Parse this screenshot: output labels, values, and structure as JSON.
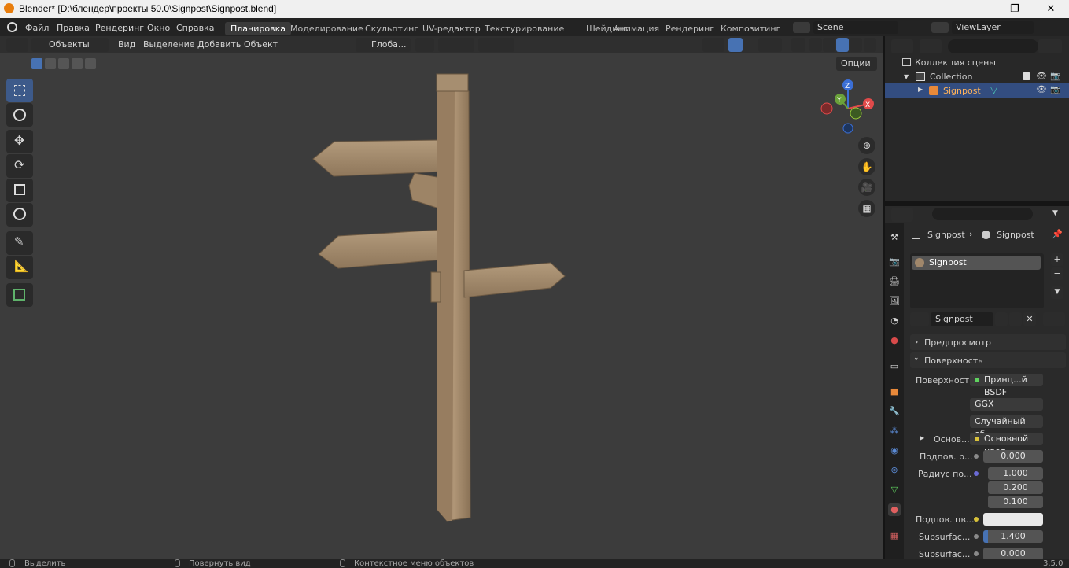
{
  "window": {
    "title": "Blender* [D:\\блендер\\проекты 50.0\\Signpost\\Signpost.blend]",
    "controls": {
      "minimize": "—",
      "maximize": "❐",
      "close": "✕"
    }
  },
  "menu": [
    "Файл",
    "Правка",
    "Рендеринг",
    "Окно",
    "Справка"
  ],
  "workspaces": [
    "Планировка",
    "Моделирование",
    "Скульптинг",
    "UV-редактор",
    "Текстурирование",
    "Шейдинг",
    "Анимация",
    "Рендеринг",
    "Композитинг"
  ],
  "active_workspace": "Планировка",
  "scene": {
    "name": "Scene",
    "view_layer": "ViewLayer"
  },
  "viewport_header": {
    "mode": "Объекты",
    "menus": [
      "Вид",
      "Выделение",
      "Добавить",
      "Объект"
    ],
    "transform_orientation": "Глоба...",
    "options": "Опции"
  },
  "gizmo": {
    "x": "X",
    "y": "Y",
    "z": "Z"
  },
  "outliner": {
    "root": "Коллекция сцены",
    "collection": "Collection",
    "object": "Signpost"
  },
  "properties": {
    "breadcrumb": [
      "Signpost",
      "Signpost"
    ],
    "material_slot": "Signpost",
    "material_name": "Signpost",
    "panels": {
      "preview": "Предпросмотр",
      "surface": "Поверхность"
    },
    "rows": {
      "surface_label": "Поверхность",
      "surface_value": "Принц...й BSDF",
      "distribution": "GGX",
      "subsurface_method": "Случайный об...",
      "base_label": "Основ...",
      "base_value": "Основной цвет",
      "subsurface_label": "Подпов. р...",
      "subsurface_value": "0.000",
      "radius_label": "Радиус по...",
      "radius": [
        "1.000",
        "0.200",
        "0.100"
      ],
      "subsurface_color_label": "Подпов. цв...",
      "subsurface_ior_label": "Subsurfac...",
      "subsurface_ior": "1.400",
      "subsurface_aniso_label": "Subsurfac...",
      "subsurface_aniso": "0.000"
    }
  },
  "status_bar": {
    "select": "Выделить",
    "rotate": "Повернуть вид",
    "context": "Контекстное меню объектов",
    "version": "3.5.0"
  },
  "colors": {
    "accent": "#4772b3",
    "wood": "#a58c71",
    "viewport_bg": "#3c3c3c"
  }
}
